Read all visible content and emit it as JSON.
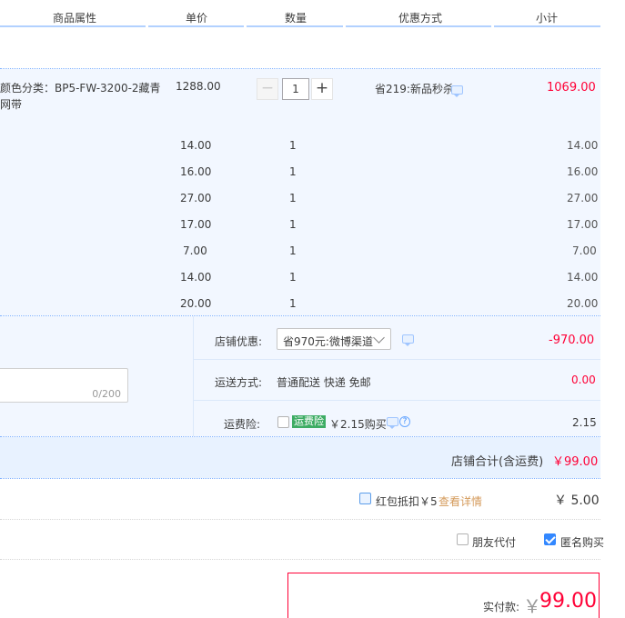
{
  "header": {
    "col_props": "商品属性",
    "col_price": "单价",
    "col_qty": "数量",
    "col_discount": "优惠方式",
    "col_subtotal": "小计"
  },
  "main_item": {
    "attr_line1": "颜色分类：BP5-FW-3200-2藏青",
    "attr_line2": "网带",
    "price": "1288.00",
    "qty_minus": "−",
    "qty": "1",
    "qty_plus": "+",
    "discount": "省219:新品秒杀",
    "subtotal": "1069.00"
  },
  "sub_items": [
    {
      "price": "14.00",
      "qty": "1",
      "subtotal": "14.00"
    },
    {
      "price": "16.00",
      "qty": "1",
      "subtotal": "16.00"
    },
    {
      "price": "27.00",
      "qty": "1",
      "subtotal": "27.00"
    },
    {
      "price": "17.00",
      "qty": "1",
      "subtotal": "17.00"
    },
    {
      "price": "7.00",
      "qty": "1",
      "subtotal": "7.00"
    },
    {
      "price": "14.00",
      "qty": "1",
      "subtotal": "14.00"
    },
    {
      "price": "20.00",
      "qty": "1",
      "subtotal": "20.00"
    }
  ],
  "store": {
    "coupon_label": "店铺优惠:",
    "coupon_selected": "省970元:微博渠道",
    "coupon_amount": "-970.00",
    "shipping_label": "运送方式:",
    "shipping_value": "普通配送 快递 免邮",
    "shipping_amount": "0.00",
    "insurance_label": "运费险:",
    "insurance_badge": "运费险",
    "insurance_price": "￥2.15购买",
    "insurance_amount": "2.15",
    "message_counter": "0/200",
    "total_label": "店铺合计(含运费)",
    "total_value": "￥99.00"
  },
  "redpacket": {
    "label": "红包抵扣￥5",
    "link": "查看详情",
    "amount": "￥ 5.00"
  },
  "options": {
    "friend_pay": "朋友代付",
    "anonymous": "匿名购买"
  },
  "payment": {
    "label": "实付款:",
    "currency": "￥",
    "amount": "99.00"
  },
  "colors": {
    "accent_red": "#ff0036",
    "band_blue": "#f2f7ff",
    "link_orange": "#d49a5a",
    "badge_green": "#3dac64"
  }
}
